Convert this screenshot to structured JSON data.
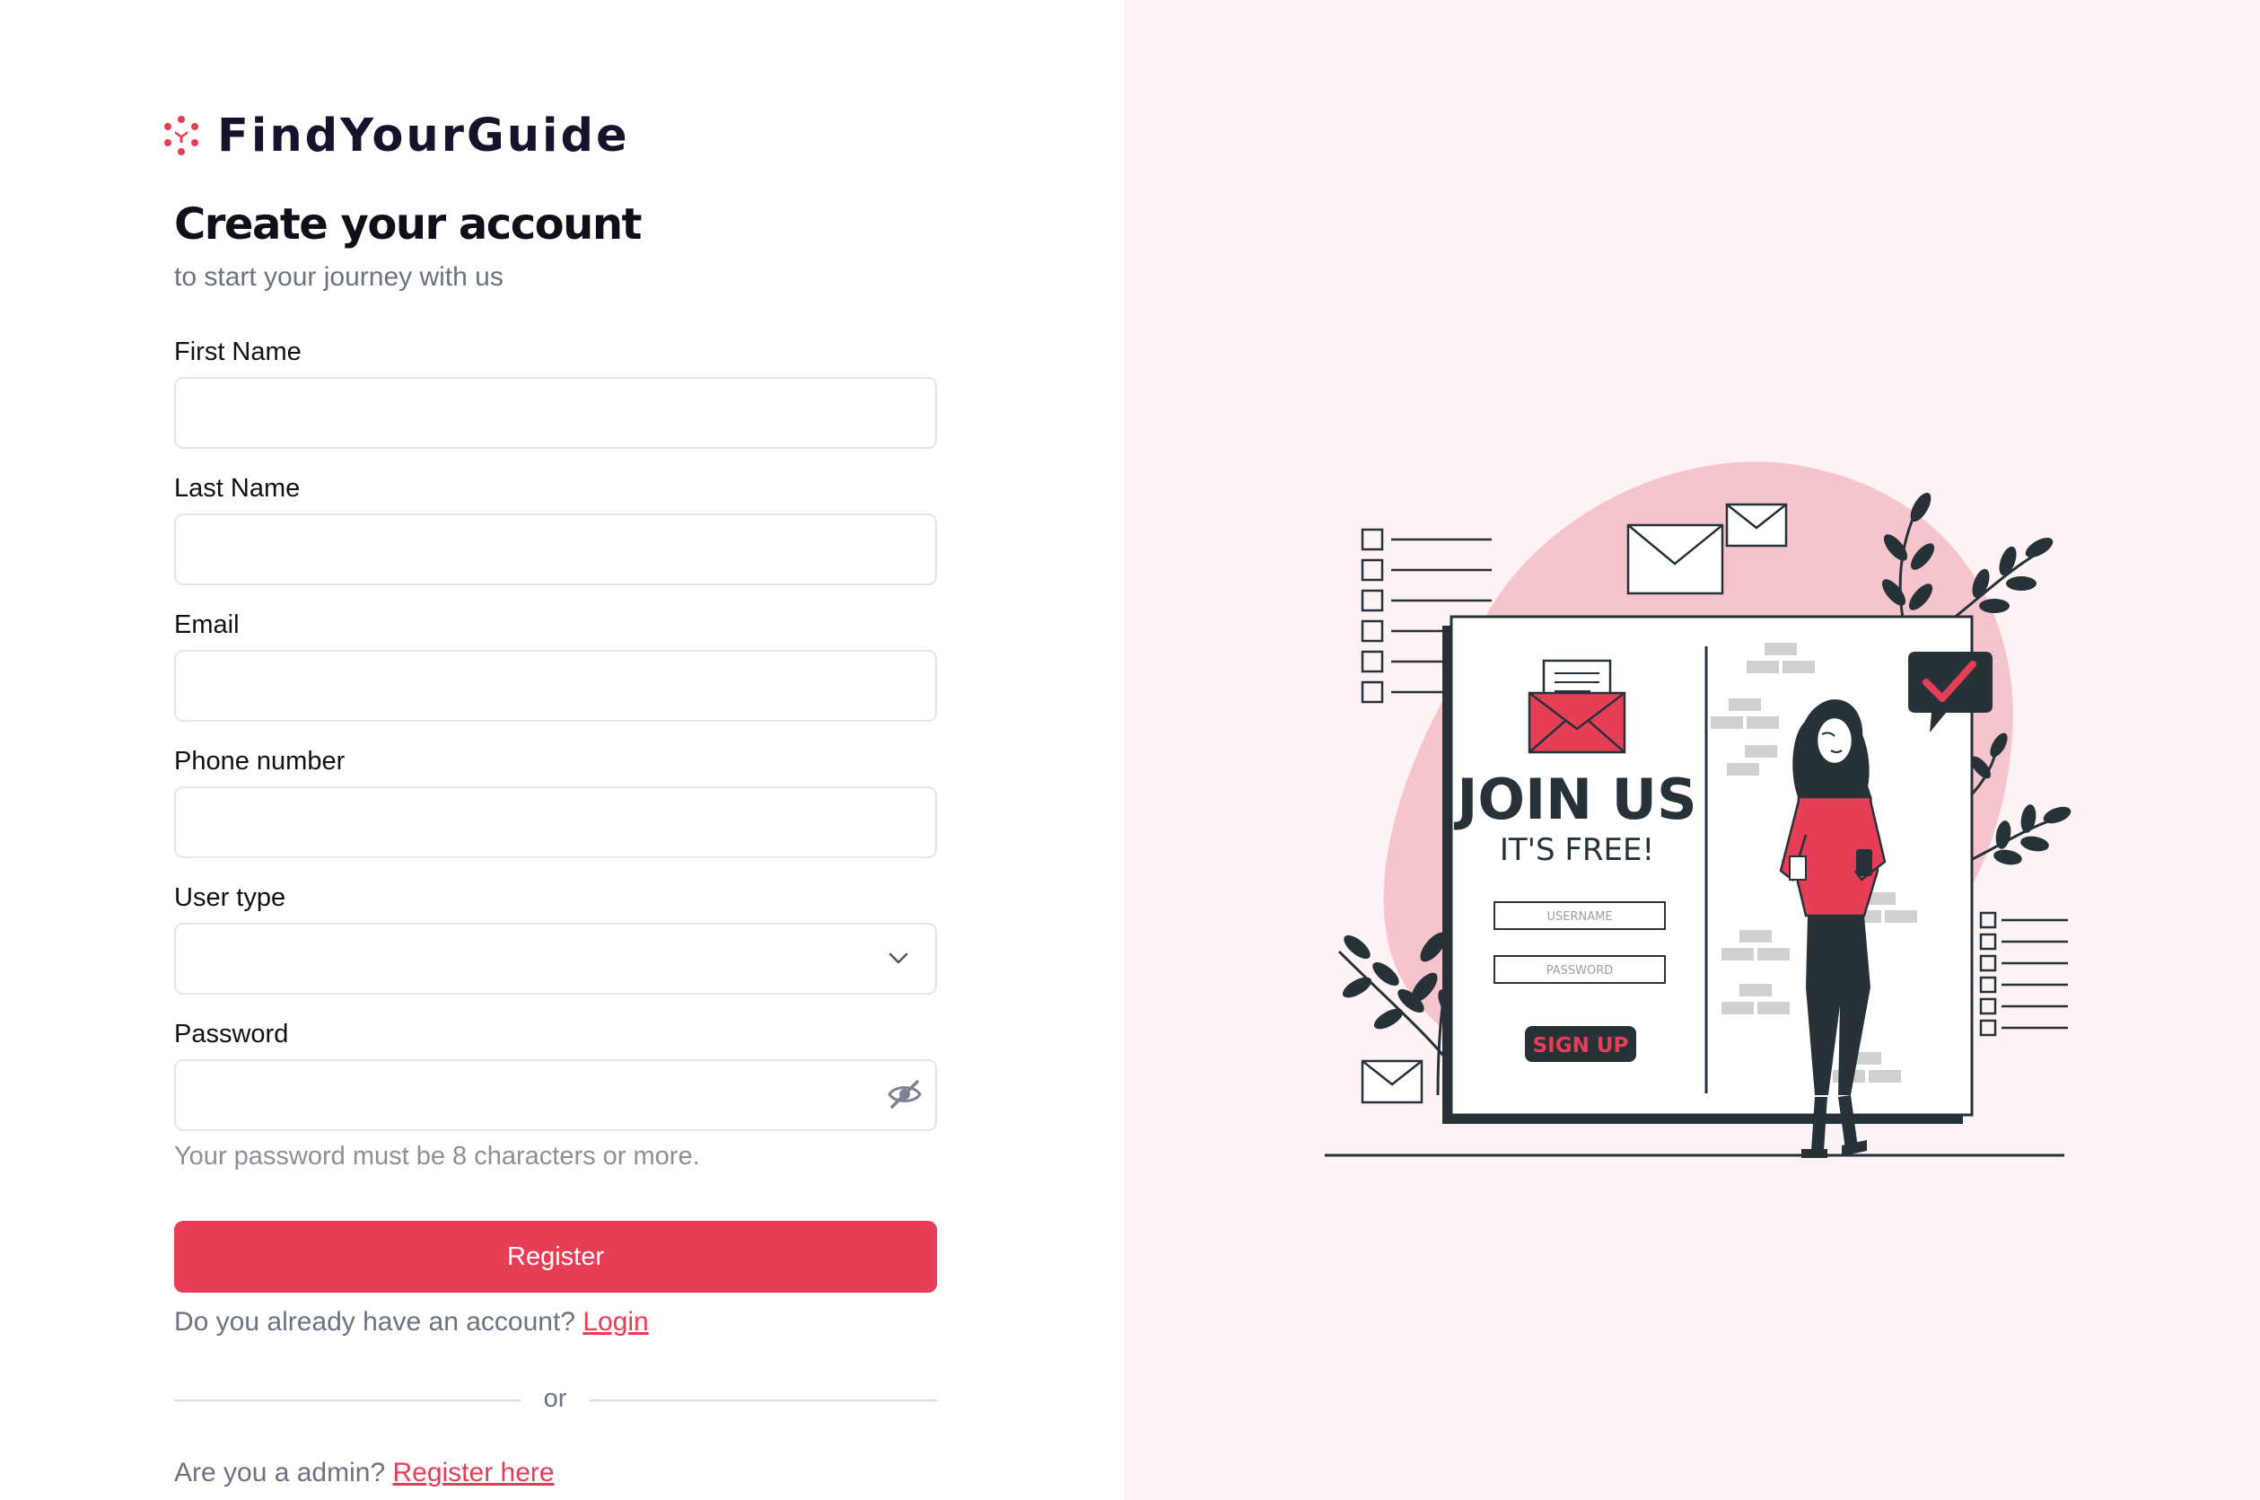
{
  "brand": {
    "name": "FindYourGuide",
    "logo_icon": "guide-logo-icon",
    "accent": "#e63e56"
  },
  "header": {
    "title": "Create your account",
    "subtitle": "to start your journey with us"
  },
  "form": {
    "first_name": {
      "label": "First Name",
      "value": ""
    },
    "last_name": {
      "label": "Last Name",
      "value": ""
    },
    "email": {
      "label": "Email",
      "value": ""
    },
    "phone": {
      "label": "Phone number",
      "value": ""
    },
    "user_type": {
      "label": "User type",
      "selected": "",
      "icon": "chevron-down-icon"
    },
    "password": {
      "label": "Password",
      "value": "",
      "icon": "eye-slash-icon",
      "hint": "Your password must be 8 characters or more."
    },
    "submit_label": "Register"
  },
  "login_prompt": {
    "text": "Do you already have an account?",
    "link": "Login"
  },
  "divider": {
    "text": "or"
  },
  "admin_prompt": {
    "text": "Are you a admin?",
    "link": "Register here"
  },
  "illustration": {
    "heading": "JOIN US",
    "subheading": "IT'S FREE!",
    "username_placeholder": "USERNAME",
    "password_placeholder": "PASSWORD",
    "signup_label": "SIGN UP",
    "colors": {
      "blob": "#f6c4cc",
      "dark": "#263238",
      "red": "#e63e56"
    }
  }
}
